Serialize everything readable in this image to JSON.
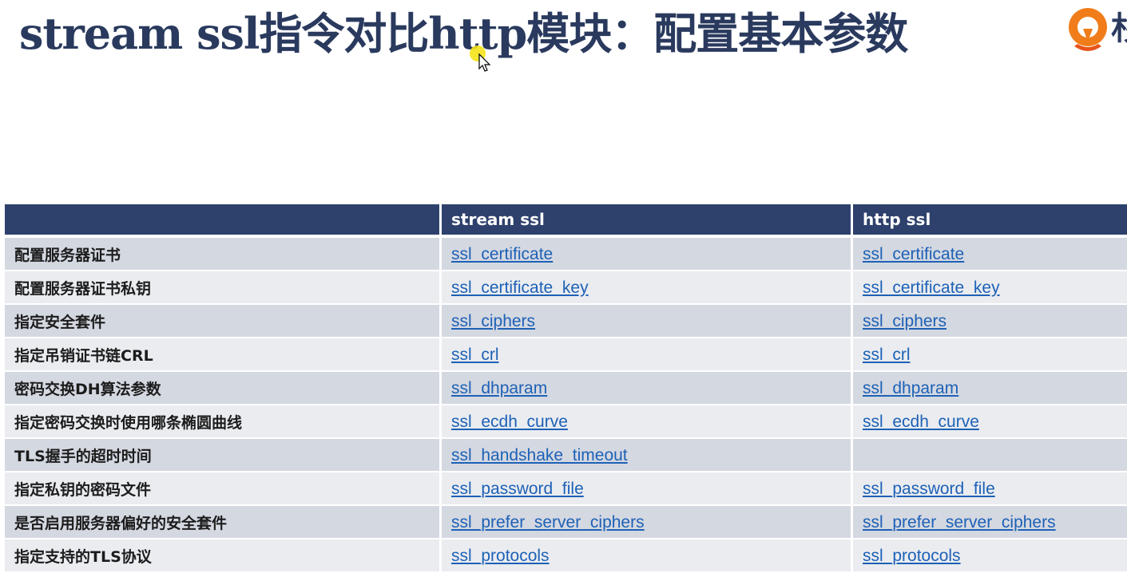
{
  "title": "stream ssl指令对比http模块：配置基本参数",
  "logo_glyph": "杉",
  "table": {
    "headers": [
      "",
      "stream ssl",
      "http ssl"
    ],
    "rows": [
      {
        "label": "配置服务器证书",
        "stream": "ssl_certificate",
        "http": "ssl_certificate"
      },
      {
        "label": "配置服务器证书私钥",
        "stream": "ssl_certificate_key",
        "http": "ssl_certificate_key"
      },
      {
        "label": "指定安全套件",
        "stream": "ssl_ciphers",
        "http": "ssl_ciphers"
      },
      {
        "label": "指定吊销证书链CRL",
        "stream": "ssl_crl",
        "http": "ssl_crl"
      },
      {
        "label": "密码交换DH算法参数",
        "stream": "ssl_dhparam",
        "http": "ssl_dhparam"
      },
      {
        "label": "指定密码交换时使用哪条椭圆曲线",
        "stream": "ssl_ecdh_curve",
        "http": "ssl_ecdh_curve"
      },
      {
        "label": "TLS握手的超时时间",
        "stream": "ssl_handshake_timeout",
        "http": ""
      },
      {
        "label": "指定私钥的密码文件",
        "stream": "ssl_password_file",
        "http": "ssl_password_file"
      },
      {
        "label": "是否启用服务器偏好的安全套件",
        "stream": "ssl_prefer_server_ciphers",
        "http": "ssl_prefer_server_ciphers"
      },
      {
        "label": "指定支持的TLS协议",
        "stream": "ssl_protocols",
        "http": "ssl_protocols"
      }
    ]
  },
  "colors": {
    "header_bg": "#2e416d",
    "row_odd": "#d4d8e1",
    "row_even": "#eaecf0",
    "link": "#1d61b6",
    "title": "#2a3a5e",
    "logo_orange": "#f07d1a"
  }
}
